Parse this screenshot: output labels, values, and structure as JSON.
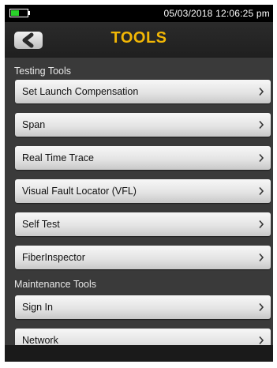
{
  "status_bar": {
    "datetime": "05/03/2018 12:06:25 pm",
    "battery_level": 0.5,
    "battery_color": "#2ad12a"
  },
  "header": {
    "title": "TOOLS",
    "back_icon": "back-arrow-icon",
    "title_color": "#f2b705"
  },
  "sections": [
    {
      "label": "Testing Tools",
      "items": [
        "Set Launch Compensation",
        "Span",
        "Real Time Trace",
        "Visual Fault Locator (VFL)",
        "Self Test",
        "FiberInspector"
      ]
    },
    {
      "label": "Maintenance Tools",
      "items": [
        "Sign In",
        "Network"
      ]
    }
  ],
  "chevron_icon": "chevron-right-icon"
}
